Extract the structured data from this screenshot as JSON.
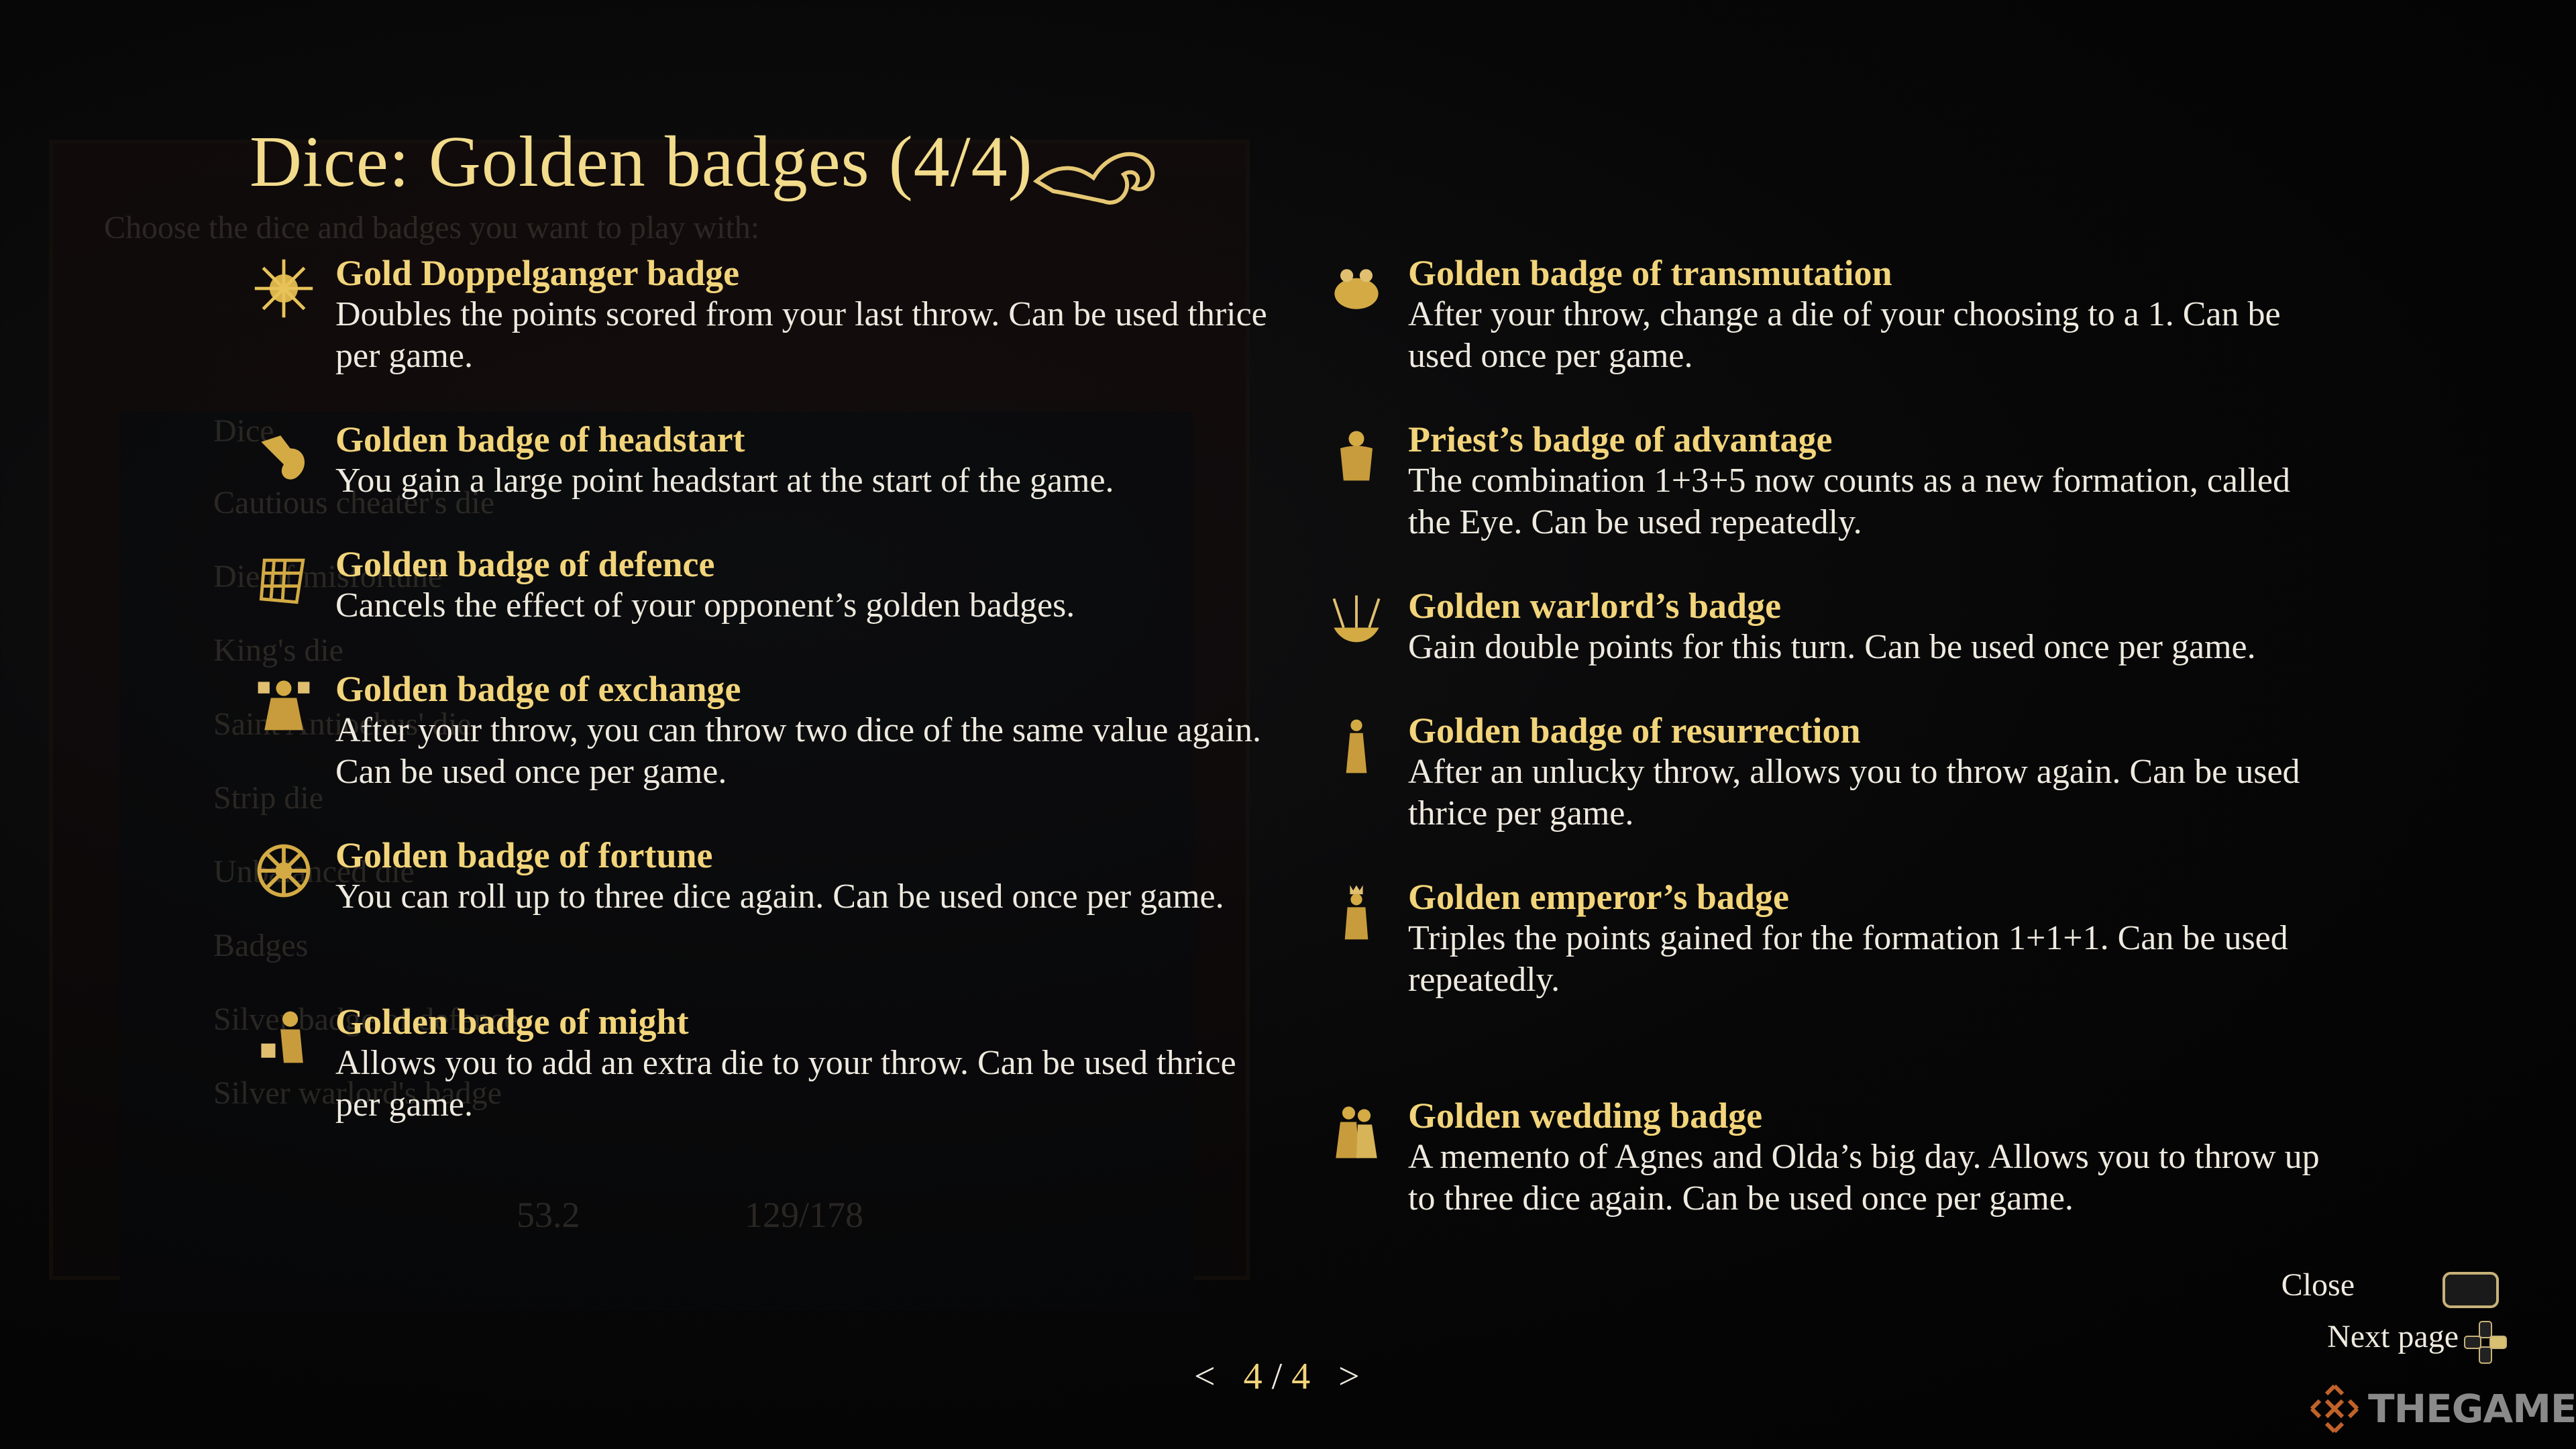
{
  "title": "Dice: Golden badges (4/4)",
  "background_panel": {
    "subtitle": "Choose the dice and badges you want to play with:",
    "rows": [
      "Dice",
      "Cautious cheater's die",
      "Die of misfortune",
      "King's die",
      "Saint Antiochus' die",
      "Strip die",
      "Unbalanced die",
      "Badges",
      "Silver badge of defence",
      "Silver warlord's badge"
    ],
    "footer_weight": "53.2",
    "footer_capacity": "129/178"
  },
  "left_badges": [
    {
      "name": "Gold Doppelganger badge",
      "description": "Doubles the points scored from your last throw. Can be used thrice per game.",
      "icon": "sun-icon"
    },
    {
      "name": "Golden badge of headstart",
      "description": "You gain a large point headstart at the start of the game.",
      "icon": "dragon-icon"
    },
    {
      "name": "Golden badge of defence",
      "description": "Cancels the effect of your opponent’s golden badges.",
      "icon": "grid-shield-icon"
    },
    {
      "name": "Golden badge of exchange",
      "description": "After your throw, you can throw two dice of the same value again. Can be used once per game.",
      "icon": "figure-icon"
    },
    {
      "name": "Golden badge of fortune",
      "description": "You can roll up to three dice again. Can be used once per game.",
      "icon": "wheel-icon"
    },
    {
      "name": "Golden badge of might",
      "description": "Allows you to add an extra die to your throw. Can be used thrice per game.",
      "icon": "strongman-icon"
    }
  ],
  "right_badges": [
    {
      "name": "Golden badge of transmutation",
      "description": "After your throw, change a die of your choosing to a 1. Can be used once per game.",
      "icon": "frog-icon"
    },
    {
      "name": "Priest’s badge of advantage",
      "description": "The combination 1+3+5 now counts as a new formation, called the Eye. Can be used repeatedly.",
      "icon": "priest-icon"
    },
    {
      "name": "Golden warlord’s badge",
      "description": "Gain double points for this turn. Can be used once per game.",
      "icon": "crown-icon"
    },
    {
      "name": "Golden badge of resurrection",
      "description": "After an unlucky throw, allows you to throw again. Can be used thrice per game.",
      "icon": "saint-icon"
    },
    {
      "name": "Golden emperor’s badge",
      "description": "Triples the points gained for the formation 1+1+1. Can be used repeatedly.",
      "icon": "emperor-icon"
    },
    {
      "name": "Golden wedding badge",
      "description": "A memento of Agnes and Olda’s big day. Allows you to throw up to three dice again. Can be used once per game.",
      "icon": "couple-icon"
    }
  ],
  "pagination": {
    "prev": "<",
    "current": "4",
    "separator": "/",
    "total": "4",
    "next": ">"
  },
  "hints": {
    "close": "Close",
    "next_page": "Next page"
  },
  "watermark": "THEGAMER",
  "colors": {
    "title": "#f2dc8c",
    "badge_name": "#f2d47a",
    "text": "#efeadf",
    "logo_orange": "#c0622a"
  }
}
